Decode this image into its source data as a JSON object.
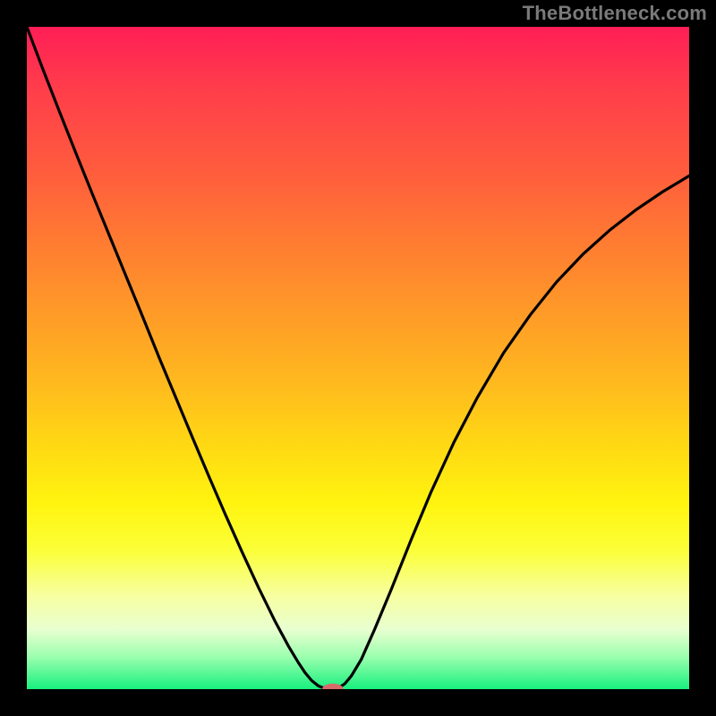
{
  "watermark": "TheBottleneck.com",
  "colors": {
    "frame": "#000000",
    "gradient_top": "#ff1e56",
    "gradient_mid": "#ffd814",
    "gradient_bottom": "#18f07e",
    "curve": "#000000",
    "marker": "#d86a6a"
  },
  "chart_data": {
    "type": "line",
    "title": "",
    "xlabel": "",
    "ylabel": "",
    "xlim": [
      0,
      1
    ],
    "ylim": [
      0,
      1
    ],
    "x": [
      0.0,
      0.025,
      0.05,
      0.075,
      0.1,
      0.125,
      0.15,
      0.175,
      0.2,
      0.225,
      0.25,
      0.275,
      0.3,
      0.325,
      0.35,
      0.375,
      0.395,
      0.41,
      0.42,
      0.43,
      0.44,
      0.45,
      0.455,
      0.46,
      0.465,
      0.472,
      0.48,
      0.49,
      0.505,
      0.525,
      0.55,
      0.58,
      0.61,
      0.645,
      0.68,
      0.72,
      0.76,
      0.8,
      0.84,
      0.88,
      0.92,
      0.96,
      1.0
    ],
    "y": [
      1.0,
      0.934,
      0.87,
      0.807,
      0.745,
      0.684,
      0.623,
      0.562,
      0.5,
      0.44,
      0.38,
      0.321,
      0.263,
      0.207,
      0.153,
      0.102,
      0.065,
      0.04,
      0.025,
      0.013,
      0.005,
      0.001,
      0.0,
      0.0,
      0.001,
      0.003,
      0.008,
      0.02,
      0.045,
      0.09,
      0.15,
      0.225,
      0.297,
      0.373,
      0.44,
      0.508,
      0.565,
      0.615,
      0.657,
      0.693,
      0.724,
      0.751,
      0.775
    ],
    "marker": {
      "x": 0.462,
      "y": 0.0,
      "rx": 0.016,
      "ry": 0.0085
    }
  }
}
